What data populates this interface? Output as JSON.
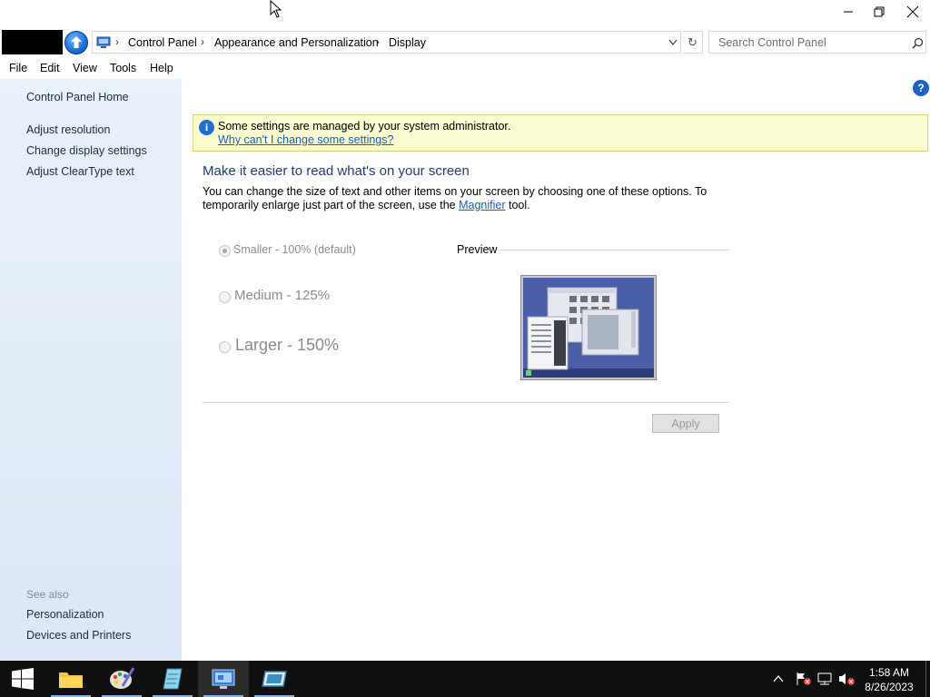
{
  "window": {
    "minimize_label": "—",
    "maximize_label": "❐",
    "close_label": "✕"
  },
  "address": {
    "crumbs": [
      "Control Panel",
      "Appearance and Personalization",
      "Display"
    ]
  },
  "search": {
    "placeholder": "Search Control Panel"
  },
  "menu": {
    "items": [
      "File",
      "Edit",
      "View",
      "Tools",
      "Help"
    ]
  },
  "sidebar": {
    "home": "Control Panel Home",
    "links": [
      "Adjust resolution",
      "Change display settings",
      "Adjust ClearType text"
    ],
    "see_also_label": "See also",
    "see_also": [
      "Personalization",
      "Devices and Printers"
    ]
  },
  "infobar": {
    "text": "Some settings are managed by your system administrator.",
    "link": "Why can't I change some settings?"
  },
  "main": {
    "heading": "Make it easier to read what's on your screen",
    "desc_before": "You can change the size of text and other items on your screen by choosing one of these options. To temporarily enlarge just part of the screen, use the ",
    "desc_link": "Magnifier",
    "desc_after": " tool.",
    "options": [
      {
        "label": "Smaller - 100% (default)",
        "checked": true
      },
      {
        "label": "Medium - 125%",
        "checked": false
      },
      {
        "label": "Larger - 150%",
        "checked": false
      }
    ],
    "preview_label": "Preview",
    "apply_label": "Apply"
  },
  "taskbar": {
    "time": "1:58 AM",
    "date": "8/26/2023"
  }
}
